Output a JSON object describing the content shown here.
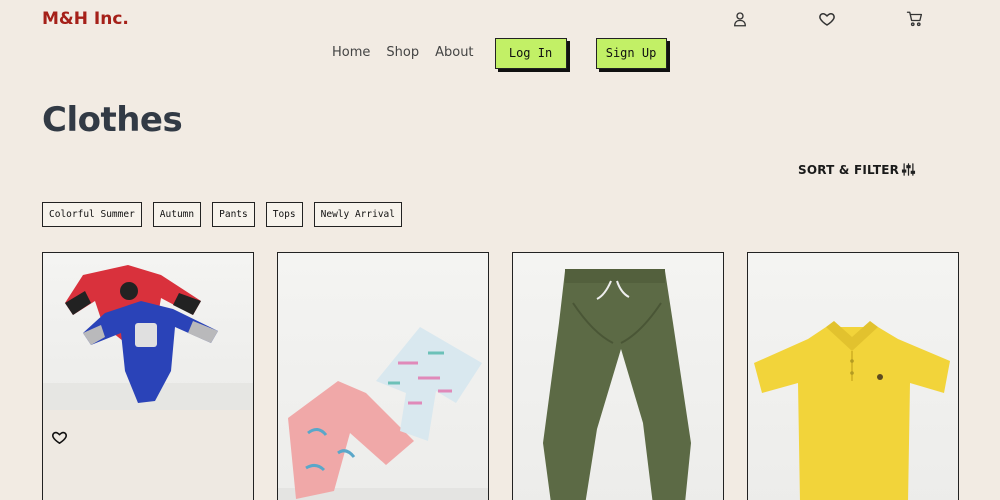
{
  "header": {
    "brand": "M&H Inc.",
    "icons": [
      "user-icon",
      "heart-icon",
      "cart-icon"
    ]
  },
  "nav": {
    "links": [
      "Home",
      "Shop",
      "About"
    ],
    "login_label": "Log In",
    "signup_label": "Sign Up"
  },
  "page": {
    "title": "Clothes",
    "sort_label": "SORT & FILTER"
  },
  "filters": [
    "Colorful Summer",
    "Autumn",
    "Pants",
    "Tops",
    "Newly Arrival"
  ],
  "colors": {
    "brand": "#a52019",
    "background": "#f2ebe3",
    "button_accent": "#c2f066",
    "title": "#323a45"
  },
  "products": [
    {
      "image": "onesies-photo",
      "favorite_icon": "heart-outline-icon"
    },
    {
      "image": "shorts-photo"
    },
    {
      "image": "green-pants-photo"
    },
    {
      "image": "yellow-polo-photo"
    }
  ]
}
